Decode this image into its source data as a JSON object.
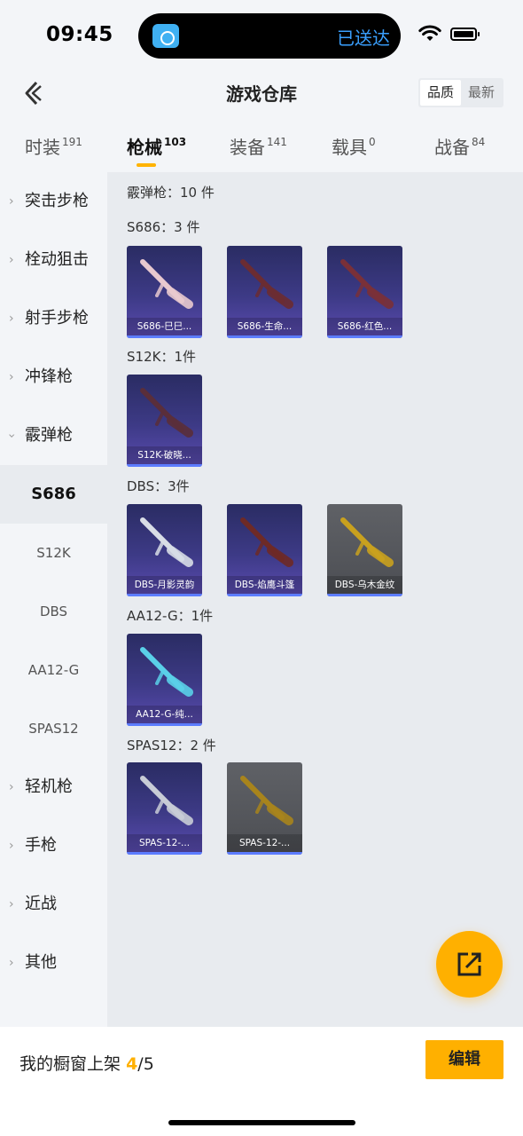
{
  "status": {
    "time": "09:45",
    "island_text": "已送达"
  },
  "nav": {
    "title": "游戏仓库",
    "sort_options": [
      "品质",
      "最新"
    ],
    "sort_selected": "品质"
  },
  "tabs": [
    {
      "label": "时装",
      "count": "191"
    },
    {
      "label": "枪械",
      "count": "103"
    },
    {
      "label": "装备",
      "count": "141"
    },
    {
      "label": "载具",
      "count": "0"
    },
    {
      "label": "战备",
      "count": "84"
    }
  ],
  "active_tab": "枪械",
  "sidebar": {
    "categories": [
      "突击步枪",
      "栓动狙击",
      "射手步枪",
      "冲锋枪",
      "霰弹枪",
      "轻机枪",
      "手枪",
      "近战",
      "其他"
    ],
    "expanded": "霰弹枪",
    "subitems": [
      "S686",
      "S12K",
      "DBS",
      "AA12-G",
      "SPAS12"
    ],
    "selected_sub": "S686"
  },
  "content": {
    "summary": "霰弹枪：10 件",
    "groups": [
      {
        "title": "S686：3 件",
        "items": [
          {
            "label": "S686-巳巳...",
            "style": "purple",
            "gun": "#e8c9cf"
          },
          {
            "label": "S686-生命...",
            "style": "purple",
            "gun": "#6b2c32"
          },
          {
            "label": "S686-红色...",
            "style": "purple",
            "gun": "#7a3038"
          }
        ]
      },
      {
        "title": "S12K：1件",
        "items": [
          {
            "label": "S12K-破晓...",
            "style": "purple",
            "gun": "#5a2e3a"
          }
        ]
      },
      {
        "title": "DBS：3件",
        "items": [
          {
            "label": "DBS-月影灵韵",
            "style": "purple",
            "gun": "#d8dde6"
          },
          {
            "label": "DBS-焰鹰斗篷",
            "style": "purple",
            "gun": "#6e2a26"
          },
          {
            "label": "DBS-乌木金纹",
            "style": "gray",
            "gun": "#c9a11e"
          }
        ]
      },
      {
        "title": "AA12-G：1件",
        "items": [
          {
            "label": "AA12-G-纯...",
            "style": "purple",
            "gun": "#5ad0e8"
          }
        ]
      },
      {
        "title": "SPAS12：2 件",
        "items": [
          {
            "label": "SPAS-12-...",
            "style": "purple",
            "gun": "#c8ccd6"
          },
          {
            "label": "SPAS-12-...",
            "style": "gray",
            "gun": "#a8841c"
          }
        ]
      }
    ]
  },
  "footer": {
    "label": "我的橱窗上架",
    "count": "4",
    "total": "/5",
    "edit_label": "编辑"
  },
  "colors": {
    "accent": "#ffb000",
    "card_purple": "#3d3a86",
    "card_gray": "#5a5c61",
    "rarity_bar": "#5c7cff"
  }
}
